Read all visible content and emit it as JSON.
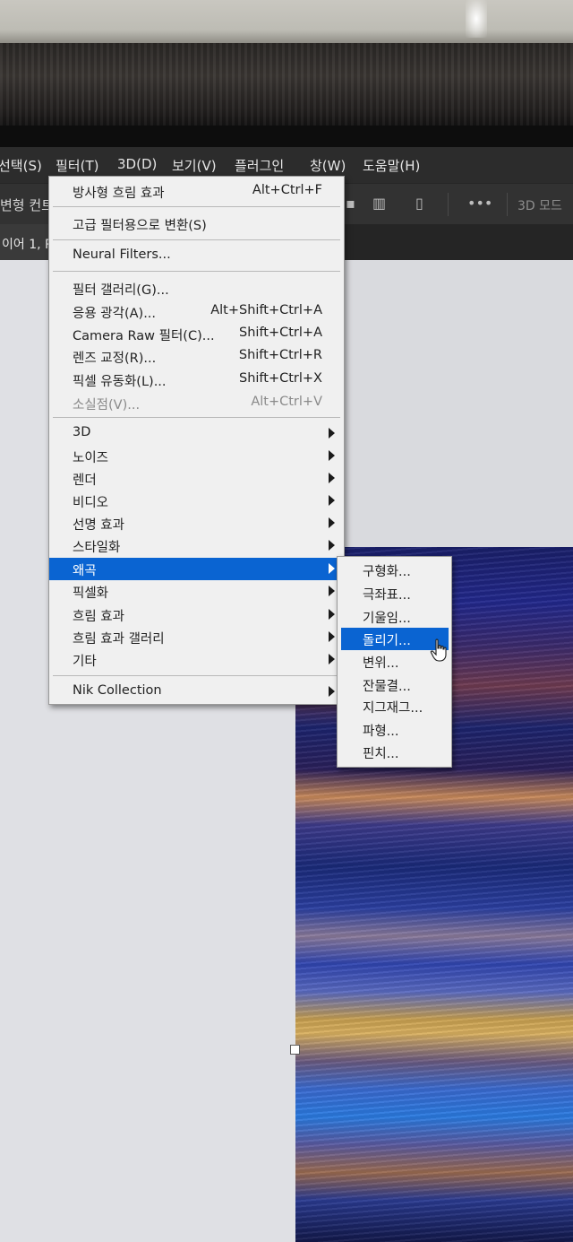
{
  "menubar": {
    "items": [
      "선택(S)",
      "필터(T)",
      "3D(D)",
      "보기(V)",
      "플러그인",
      "창(W)",
      "도움말(H)"
    ]
  },
  "optionsbar": {
    "left_text": "변형 컨트",
    "mode_label": "3D 모드"
  },
  "tabs": {
    "active": "이어 1, R"
  },
  "filter_menu": {
    "top_items": [
      {
        "label": "방사형 흐림 효과",
        "shortcut": "Alt+Ctrl+F"
      },
      {
        "label": "고급 필터용으로 변환(S)"
      },
      {
        "label": "Neural Filters..."
      }
    ],
    "gallery_items": [
      {
        "label": "필터 갤러리(G)...",
        "shortcut": ""
      },
      {
        "label": "응용 광각(A)...",
        "shortcut": "Alt+Shift+Ctrl+A"
      },
      {
        "label": "Camera Raw 필터(C)...",
        "shortcut": "Shift+Ctrl+A"
      },
      {
        "label": "렌즈 교정(R)...",
        "shortcut": "Shift+Ctrl+R"
      },
      {
        "label": "픽셀 유동화(L)...",
        "shortcut": "Shift+Ctrl+X"
      },
      {
        "label": "소실점(V)...",
        "shortcut": "Alt+Ctrl+V"
      }
    ],
    "submenu_items": [
      "3D",
      "노이즈",
      "렌더",
      "비디오",
      "선명 효과",
      "스타일화",
      "왜곡",
      "픽셀화",
      "흐림 효과",
      "흐림 효과 갤러리",
      "기타"
    ],
    "active_item": "왜곡",
    "bottom_item": "Nik Collection"
  },
  "distort_submenu": {
    "items": [
      "구형화...",
      "극좌표...",
      "기울임...",
      "돌리기...",
      "변위...",
      "잔물결...",
      "지그재그...",
      "파형...",
      "핀치..."
    ],
    "highlighted": "돌리기..."
  },
  "colors": {
    "menu_bg": "#f0f0f0",
    "highlight": "#0a64d2",
    "app_dark": "#2c2c2c"
  }
}
